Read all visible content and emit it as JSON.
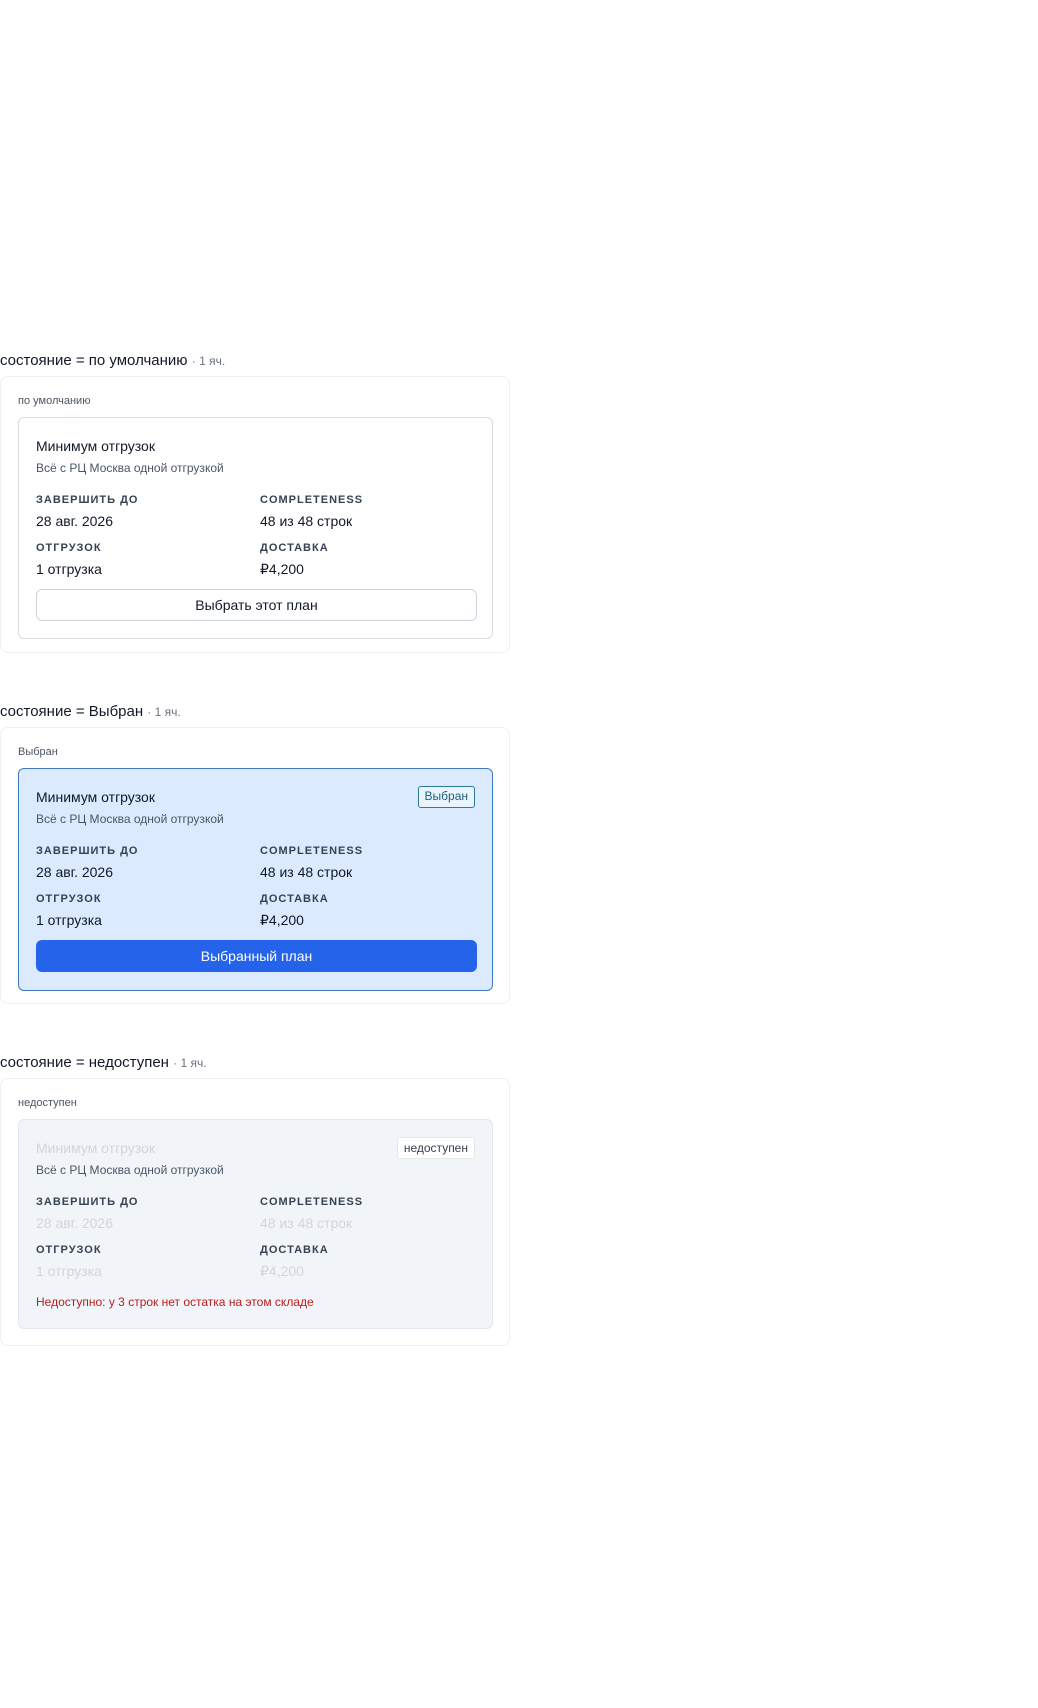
{
  "sections": [
    {
      "header_state": "состояние = по умолчанию",
      "header_meta": "· 1 яч.",
      "frame_label": "по умолчанию",
      "card": {
        "title": "Минимум отгрузок",
        "subtitle": "Всё с РЦ Москва одной отгрузкой",
        "finish_by_label": "ЗАВЕРШИТЬ ДО",
        "finish_by_value": "28 авг. 2026",
        "completeness_label": "COMPLETENESS",
        "completeness_value": "48 из 48 строк",
        "shipments_label": "ОТГРУЗОК",
        "shipments_value": "1 отгрузка",
        "delivery_label": "ДОСТАВКА",
        "delivery_value": "₽4,200",
        "button_label": "Выбрать этот план"
      }
    },
    {
      "header_state": "состояние = Выбран",
      "header_meta": "· 1 яч.",
      "frame_label": "Выбран",
      "card": {
        "title": "Минимум отгрузок",
        "subtitle": "Всё с РЦ Москва одной отгрузкой",
        "badge": "Выбран",
        "finish_by_label": "ЗАВЕРШИТЬ ДО",
        "finish_by_value": "28 авг. 2026",
        "completeness_label": "COMPLETENESS",
        "completeness_value": "48 из 48 строк",
        "shipments_label": "ОТГРУЗОК",
        "shipments_value": "1 отгрузка",
        "delivery_label": "ДОСТАВКА",
        "delivery_value": "₽4,200",
        "button_label": "Выбранный план"
      }
    },
    {
      "header_state": "состояние = недоступен",
      "header_meta": "· 1 яч.",
      "frame_label": "недоступен",
      "card": {
        "title": "Минимум отгрузок",
        "subtitle": "Всё с РЦ Москва одной отгрузкой",
        "badge": "недоступен",
        "finish_by_label": "ЗАВЕРШИТЬ ДО",
        "finish_by_value": "28 авг. 2026",
        "completeness_label": "COMPLETENESS",
        "completeness_value": "48 из 48 строк",
        "shipments_label": "ОТГРУЗОК",
        "shipments_value": "1 отгрузка",
        "delivery_label": "ДОСТАВКА",
        "delivery_value": "₽4,200",
        "error_text": "Недоступно: у 3 строк нет остатка на этом складе"
      }
    }
  ],
  "colors": {
    "primary": "#2563eb",
    "selected_bg": "#dbeafe",
    "selected_border": "#3b7bbf",
    "unavailable_bg": "#f1f5f9",
    "error": "#b91c1c"
  }
}
